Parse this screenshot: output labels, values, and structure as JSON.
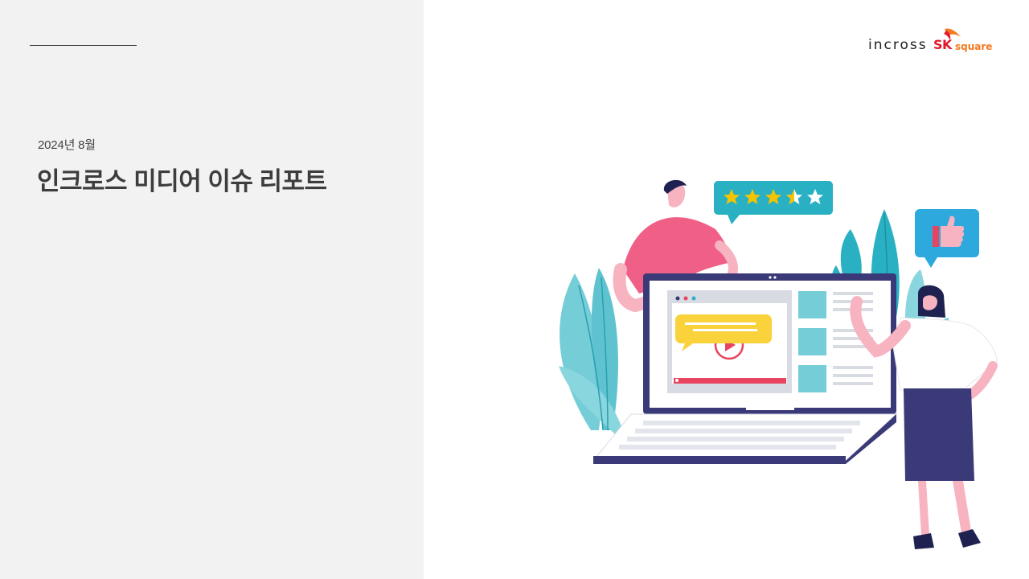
{
  "slide": {
    "date": "2024년 8월",
    "title": "인크로스 미디어 이슈 리포트"
  },
  "logo": {
    "company": "incross",
    "brand": "SK",
    "brand_sub": "square",
    "colors": {
      "sk_red": "#e3192b",
      "sk_orange": "#f47920"
    }
  },
  "illustration": {
    "rating_stars": 3.5,
    "rating_max": 5,
    "icons": [
      "star-rating-bubble",
      "thumbs-up-bubble",
      "play-icon",
      "laptop"
    ]
  },
  "colors": {
    "left_panel": "#f2f2f2",
    "title_text": "#3d3d3d",
    "teal": "#29b1c3",
    "pink": "#ef5f86",
    "navy": "#3b3a78"
  }
}
